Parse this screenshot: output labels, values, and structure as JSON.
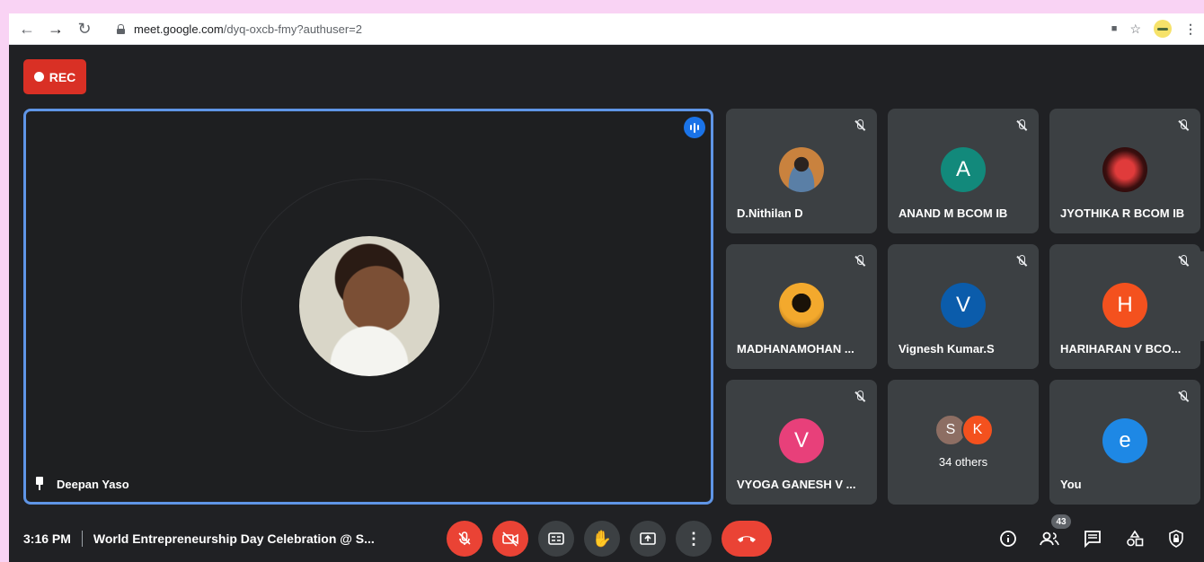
{
  "browser": {
    "url_host": "meet.google.com",
    "url_path": "/dyq-oxcb-fmy?authuser=2"
  },
  "recording": {
    "label": "REC"
  },
  "main_speaker": {
    "name": "Deepan Yaso"
  },
  "participants": [
    {
      "name": "D.Nithilan D",
      "type": "photo"
    },
    {
      "name": "ANAND M BCOM IB",
      "initial": "A",
      "color": "#12897b"
    },
    {
      "name": "JYOTHIKA R BCOM IB",
      "type": "photo"
    },
    {
      "name": "MADHANAMOHAN ...",
      "type": "photo"
    },
    {
      "name": "Vignesh Kumar.S",
      "initial": "V",
      "color": "#0b5cab"
    },
    {
      "name": "HARIHARAN V BCO...",
      "initial": "H",
      "color": "#f4511e"
    },
    {
      "name": "VYOGA GANESH V ...",
      "initial": "V",
      "color": "#e8407a"
    },
    {
      "others_label": "34 others",
      "initials": [
        "S",
        "K"
      ],
      "colors": [
        "#8d6e63",
        "#f4511e"
      ]
    },
    {
      "name": "You",
      "initial": "e",
      "color": "#1e88e5"
    }
  ],
  "bottom_bar": {
    "time": "3:16 PM",
    "meeting_title": "World Entrepreneurship Day Celebration @ S...",
    "people_count": "43"
  },
  "colors": {
    "background": "#202124",
    "tile": "#3c4043",
    "danger": "#ea4335",
    "active_border": "#5f95e6"
  }
}
